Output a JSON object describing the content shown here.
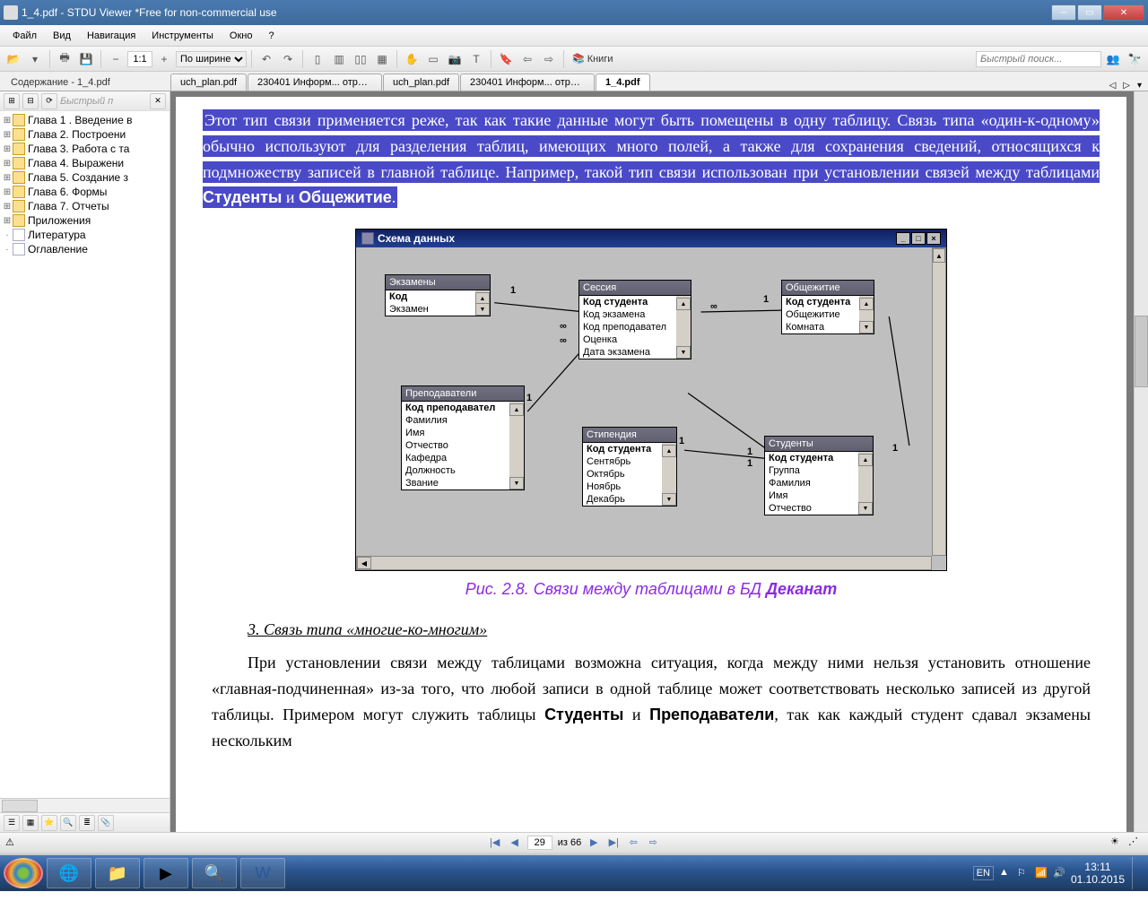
{
  "window": {
    "title": "1_4.pdf - STDU Viewer *Free for non-commercial use"
  },
  "menu": {
    "file": "Файл",
    "view": "Вид",
    "nav": "Навигация",
    "tools": "Инструменты",
    "window": "Окно",
    "help": "?"
  },
  "toolbar": {
    "zoom_ratio": "1:1",
    "zoom_mode": "По ширине",
    "books": "Книги",
    "search_placeholder": "Быстрый поиск..."
  },
  "sidebar": {
    "title": "Содержание - 1_4.pdf",
    "quick": "Быстрый п",
    "items": [
      "Глава 1 . Введение в",
      "Глава 2. Построени",
      "Глава 3. Работа с та",
      "Глава 4. Выражени",
      "Глава 5. Создание з",
      "Глава 6. Формы",
      "Глава 7. Отчеты",
      "Приложения",
      "Литература",
      "Оглавление"
    ]
  },
  "tabs": [
    "uch_plan.pdf",
    "230401 Информ... отраслям).pdf",
    "uch_plan.pdf",
    "230401 Информ... отраслям).pdf",
    "1_4.pdf"
  ],
  "active_tab": 4,
  "document": {
    "highlight_html": "Этот тип связи применяется реже, так как такие данные могут быть помещены в одну таблицу. Связь типа «один-к-одному» обычно используют для разделения таблиц, имеющих много полей, а также для сохранения сведений, относящихся к подмножеству записей в главной таблице. Например, такой тип связи использован при установлении связей между таблицами <b>Студенты</b> и <b>Общежитие</b>.",
    "figcaption_prefix": "Рис. 2.8. Связи между таблицами в БД ",
    "figcaption_bold": "Деканат",
    "h3": "3. Связь типа «многие-ко-многим»",
    "body_html": "При установлении связи между таблицами возможна ситуация, когда между ними нельзя установить отношение «главная-подчиненная» из-за того, что любой записи в одной таблице может соответствовать несколько записей из другой таблицы. Примером могут служить таблицы <b>Студенты</b> и <b>Преподаватели</b>, так как каждый студент сдавал экзамены нескольким"
  },
  "schema": {
    "title": "Схема данных",
    "tables": {
      "examens": {
        "title": "Экзамены",
        "fields": [
          "Код",
          "Экзамен"
        ]
      },
      "session": {
        "title": "Сессия",
        "fields": [
          "Код студента",
          "Код экзамена",
          "Код преподавател",
          "Оценка",
          "Дата экзамена"
        ]
      },
      "hostel": {
        "title": "Общежитие",
        "fields": [
          "Код студента",
          "Общежитие",
          "Комната"
        ]
      },
      "teachers": {
        "title": "Преподаватели",
        "fields": [
          "Код преподавател",
          "Фамилия",
          "Имя",
          "Отчество",
          "Кафедра",
          "Должность",
          "Звание"
        ]
      },
      "stipend": {
        "title": "Стипендия",
        "fields": [
          "Код студента",
          "Сентябрь",
          "Октябрь",
          "Ноябрь",
          "Декабрь"
        ]
      },
      "students": {
        "title": "Студенты",
        "fields": [
          "Код студента",
          "Группа",
          "Фамилия",
          "Имя",
          "Отчество"
        ]
      }
    },
    "labels": {
      "one": "1",
      "many": "∞"
    }
  },
  "status": {
    "page": "29",
    "of": "из 66"
  },
  "tray": {
    "lang": "EN",
    "time": "13:11",
    "date": "01.10.2015"
  }
}
